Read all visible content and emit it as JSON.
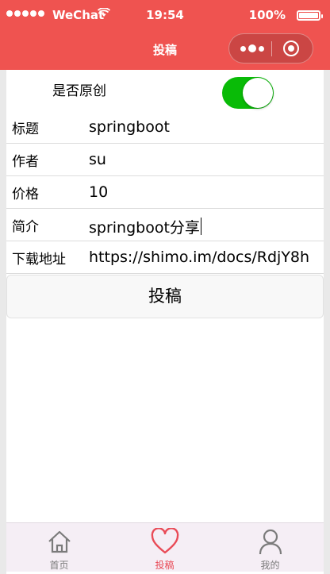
{
  "status_bar": {
    "carrier": "WeChat",
    "time": "19:54",
    "battery": "100%"
  },
  "nav": {
    "title": "投稿"
  },
  "form": {
    "original_label": "是否原创",
    "original_on": true,
    "fields": [
      {
        "label": "标题",
        "value": "springboot"
      },
      {
        "label": "作者",
        "value": "su"
      },
      {
        "label": "价格",
        "value": "10"
      },
      {
        "label": "简介",
        "value": "springboot分享"
      },
      {
        "label": "下载地址",
        "value": "https://shimo.im/docs/RdjY8h"
      }
    ],
    "submit_label": "投稿"
  },
  "tabbar": {
    "items": [
      {
        "label": "首页",
        "icon": "home-icon",
        "active": false
      },
      {
        "label": "投稿",
        "icon": "heart-icon",
        "active": true
      },
      {
        "label": "我的",
        "icon": "user-icon",
        "active": false
      }
    ]
  },
  "colors": {
    "header": "#ef5350",
    "switch_on": "#09bb07",
    "tab_active": "#e94b57"
  }
}
